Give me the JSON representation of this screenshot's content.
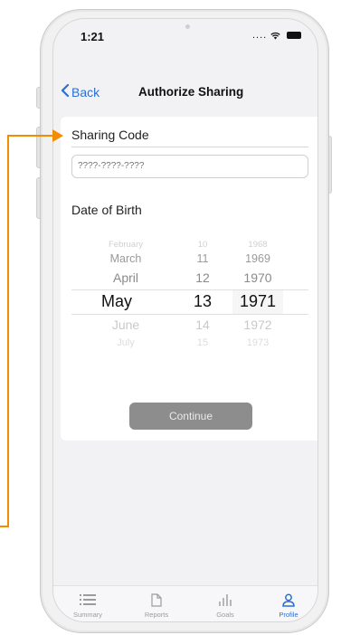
{
  "status_bar": {
    "time": "1:21",
    "signal": "....",
    "wifi_icon": "wifi-icon",
    "battery_icon": "battery-icon"
  },
  "nav": {
    "back_label": "Back",
    "title": "Authorize Sharing"
  },
  "sharing": {
    "label": "Sharing Code",
    "placeholder": "????-????-????"
  },
  "dob": {
    "label": "Date of Birth",
    "months": [
      "February",
      "March",
      "April",
      "May",
      "June",
      "July"
    ],
    "days": [
      "10",
      "11",
      "12",
      "13",
      "14",
      "15"
    ],
    "years": [
      "1968",
      "1969",
      "1970",
      "1971",
      "1972",
      "1973"
    ],
    "selected": {
      "month": "May",
      "day": "13",
      "year": "1971"
    }
  },
  "continue_label": "Continue",
  "tabs": [
    {
      "label": "Summary",
      "icon": "list-icon"
    },
    {
      "label": "Reports",
      "icon": "document-icon"
    },
    {
      "label": "Goals",
      "icon": "bar-chart-icon"
    },
    {
      "label": "Profile",
      "icon": "person-icon",
      "active": true
    }
  ],
  "colors": {
    "accent": "#2a6fd6",
    "annotation": "#f28c00",
    "button_disabled": "#8d8d8d"
  }
}
